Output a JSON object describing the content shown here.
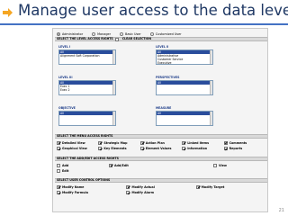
{
  "slide": {
    "title": "Manage user access to the data level",
    "page_number": "21"
  },
  "roles": [
    {
      "label": "Administrator",
      "selected": true
    },
    {
      "label": "Manager",
      "selected": false
    },
    {
      "label": "Basic User",
      "selected": false
    },
    {
      "label": "Customized User",
      "selected": false
    }
  ],
  "level_section": {
    "header": "SELECT THE LEVEL ACCESS RIGHTS",
    "clear_label": "CLEAR SELECTION",
    "lists": {
      "level1": {
        "label": "LEVEL I",
        "options": [
          "All",
          "Alignment Soft Corporation"
        ],
        "selected": 0
      },
      "level2": {
        "label": "LEVEL II",
        "options": [
          "All",
          "Administrative",
          "Customer Service",
          "Executive"
        ],
        "selected": 0
      },
      "level3": {
        "label": "LEVEL III",
        "options": [
          "All",
          "Exec 1",
          "Exec 2"
        ],
        "selected": 0
      },
      "perspectives": {
        "label": "PERSPECTIVES",
        "options": [
          "All"
        ],
        "selected": 0
      },
      "objective": {
        "label": "OBJECTIVE",
        "options": [
          "All"
        ],
        "selected": 0
      },
      "measure": {
        "label": "MEASURE",
        "options": [
          "All"
        ],
        "selected": 0
      }
    }
  },
  "menu_section": {
    "header": "SELECT THE MENU ACCESS RIGHTS",
    "items": [
      {
        "label": "Detailed View",
        "checked": true
      },
      {
        "label": "Strategic Map",
        "checked": true
      },
      {
        "label": "Action Plan",
        "checked": true
      },
      {
        "label": "Linked Items",
        "checked": true
      },
      {
        "label": "Comments",
        "checked": true
      },
      {
        "label": "Graphical View",
        "checked": true
      },
      {
        "label": "Key Elements",
        "checked": true
      },
      {
        "label": "Element Values",
        "checked": true
      },
      {
        "label": "Information",
        "checked": true
      },
      {
        "label": "Reports",
        "checked": true
      }
    ]
  },
  "add_section": {
    "header": "SELECT THE ADD/EDIT ACCESS RIGHTS",
    "items": [
      {
        "label": "Add",
        "checked": false
      },
      {
        "label": "Add/Edit",
        "checked": true
      },
      {
        "label": "View",
        "checked": false
      },
      {
        "label": "Edit",
        "checked": false
      }
    ]
  },
  "user_section": {
    "header": "SELECT USER CONTROL OPTIONS",
    "items": [
      {
        "label": "Modify Name",
        "checked": true
      },
      {
        "label": "Modify Actual",
        "checked": true
      },
      {
        "label": "Modify Target",
        "checked": true
      },
      {
        "label": "Modify Formula",
        "checked": true
      },
      {
        "label": "Modify Alarm",
        "checked": true
      }
    ]
  }
}
